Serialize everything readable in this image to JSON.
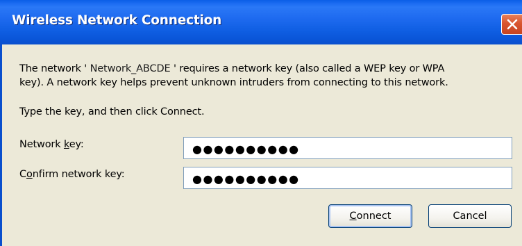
{
  "window": {
    "title": "Wireless Network Connection"
  },
  "message": {
    "line1_prefix": "The network '",
    "network_name": " Network_ABCDE ",
    "line1_suffix": "' requires a network key (also called a WEP key or WPA",
    "line2": "key). A network key helps prevent unknown intruders from connecting to this network.",
    "instruction": "Type the key, and then click Connect."
  },
  "form": {
    "network_key": {
      "label_before": "Network ",
      "label_mnemonic": "k",
      "label_after": "ey:",
      "value": "●●●●●●●●●●"
    },
    "confirm_key": {
      "label_before": "C",
      "label_mnemonic": "o",
      "label_after": "nfirm network key:",
      "value": "●●●●●●●●●●"
    }
  },
  "buttons": {
    "connect_mnemonic": "C",
    "connect_rest": "onnect",
    "cancel": "Cancel"
  },
  "icons": {
    "close": "close-icon"
  },
  "colors": {
    "titlebar": "#0a5ee6",
    "dialog_bg": "#ece9d8",
    "close_button": "#d9552f"
  }
}
